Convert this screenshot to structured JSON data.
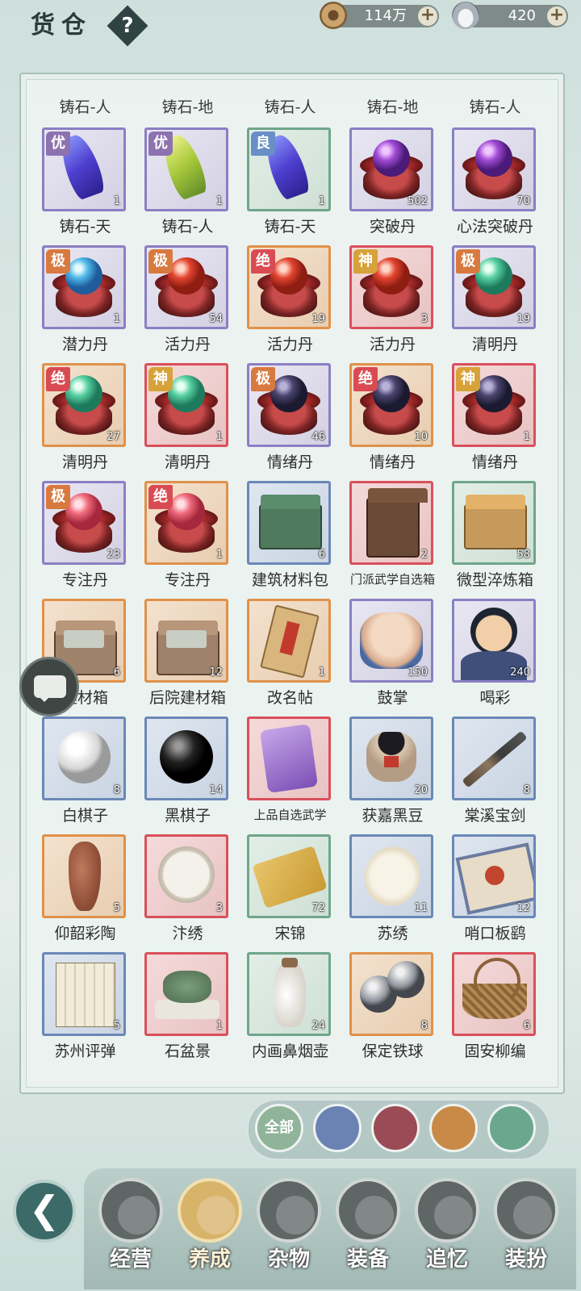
{
  "header": {
    "title": "货仓",
    "help_icon_text": "?",
    "coins": "114万",
    "silver": "420",
    "plus": "+"
  },
  "top_row_labels": [
    "铸石-人",
    "铸石-地",
    "铸石-人",
    "铸石-地",
    "铸石-人"
  ],
  "items": [
    {
      "name": "铸石-天",
      "count": "1",
      "badge": "优",
      "rarity": "purple",
      "art": "crystal-blue"
    },
    {
      "name": "铸石-人",
      "count": "1",
      "badge": "优",
      "rarity": "purple",
      "art": "crystal-yellow"
    },
    {
      "name": "铸石-天",
      "count": "1",
      "badge": "良",
      "rarity": "green",
      "art": "crystal-blue"
    },
    {
      "name": "突破丹",
      "count": "502",
      "badge": "",
      "rarity": "purple",
      "art": "orb-purple"
    },
    {
      "name": "心法突破丹",
      "count": "70",
      "badge": "",
      "rarity": "purple",
      "art": "orb-purple"
    },
    {
      "name": "潜力丹",
      "count": "1",
      "badge": "极",
      "rarity": "purple",
      "art": "orb-cyan"
    },
    {
      "name": "活力丹",
      "count": "54",
      "badge": "极",
      "rarity": "purple",
      "art": "orb-red"
    },
    {
      "name": "活力丹",
      "count": "19",
      "badge": "绝",
      "rarity": "orange",
      "art": "orb-red"
    },
    {
      "name": "活力丹",
      "count": "3",
      "badge": "神",
      "rarity": "red",
      "art": "orb-red"
    },
    {
      "name": "清明丹",
      "count": "19",
      "badge": "极",
      "rarity": "purple",
      "art": "orb-green"
    },
    {
      "name": "清明丹",
      "count": "27",
      "badge": "绝",
      "rarity": "orange",
      "art": "orb-green"
    },
    {
      "name": "清明丹",
      "count": "1",
      "badge": "神",
      "rarity": "red",
      "art": "orb-green"
    },
    {
      "name": "情绪丹",
      "count": "46",
      "badge": "极",
      "rarity": "purple",
      "art": "orb-dark"
    },
    {
      "name": "情绪丹",
      "count": "10",
      "badge": "绝",
      "rarity": "orange",
      "art": "orb-dark"
    },
    {
      "name": "情绪丹",
      "count": "1",
      "badge": "神",
      "rarity": "red",
      "art": "orb-dark"
    },
    {
      "name": "专注丹",
      "count": "23",
      "badge": "极",
      "rarity": "purple",
      "art": "orb-pink"
    },
    {
      "name": "专注丹",
      "count": "1",
      "badge": "绝",
      "rarity": "orange",
      "art": "orb-pink"
    },
    {
      "name": "建筑材料包",
      "count": "6",
      "badge": "",
      "rarity": "blue",
      "art": "chest-green"
    },
    {
      "name": "门派武学自选箱",
      "count": "2",
      "badge": "",
      "rarity": "red",
      "art": "cabinet"
    },
    {
      "name": "微型淬炼箱",
      "count": "58",
      "badge": "",
      "rarity": "green",
      "art": "chest-wood"
    },
    {
      "name": "建材箱",
      "count": "6",
      "badge": "",
      "rarity": "orange",
      "art": "box-open"
    },
    {
      "name": "后院建材箱",
      "count": "12",
      "badge": "",
      "rarity": "orange",
      "art": "box-open"
    },
    {
      "name": "改名帖",
      "count": "1",
      "badge": "",
      "rarity": "orange",
      "art": "card"
    },
    {
      "name": "鼓掌",
      "count": "150",
      "badge": "",
      "rarity": "purple",
      "art": "clap"
    },
    {
      "name": "喝彩",
      "count": "240",
      "badge": "",
      "rarity": "purple",
      "art": "cheer"
    },
    {
      "name": "白棋子",
      "count": "8",
      "badge": "",
      "rarity": "blue",
      "art": "stone-white"
    },
    {
      "name": "黑棋子",
      "count": "14",
      "badge": "",
      "rarity": "blue",
      "art": "stone-black"
    },
    {
      "name": "上品自选武学",
      "count": "",
      "badge": "",
      "rarity": "red",
      "art": "manual"
    },
    {
      "name": "获嘉黑豆",
      "count": "20",
      "badge": "",
      "rarity": "blue",
      "art": "jar"
    },
    {
      "name": "棠溪宝剑",
      "count": "8",
      "badge": "",
      "rarity": "blue",
      "art": "sword"
    },
    {
      "name": "仰韶彩陶",
      "count": "5",
      "badge": "",
      "rarity": "orange",
      "art": "vase"
    },
    {
      "name": "汴绣",
      "count": "3",
      "badge": "",
      "rarity": "red",
      "art": "embroidery"
    },
    {
      "name": "宋锦",
      "count": "72",
      "badge": "",
      "rarity": "green",
      "art": "scroll"
    },
    {
      "name": "苏绣",
      "count": "11",
      "badge": "",
      "rarity": "blue",
      "art": "fan"
    },
    {
      "name": "哨口板鹞",
      "count": "12",
      "badge": "",
      "rarity": "blue",
      "art": "kite"
    },
    {
      "name": "苏州评弹",
      "count": "5",
      "badge": "",
      "rarity": "blue",
      "art": "book"
    },
    {
      "name": "石盆景",
      "count": "1",
      "badge": "",
      "rarity": "red",
      "art": "bonsai"
    },
    {
      "name": "内画鼻烟壶",
      "count": "24",
      "badge": "",
      "rarity": "green",
      "art": "bottle"
    },
    {
      "name": "保定铁球",
      "count": "8",
      "badge": "",
      "rarity": "orange",
      "art": "balls"
    },
    {
      "name": "固安柳编",
      "count": "6",
      "badge": "",
      "rarity": "red",
      "art": "basket"
    }
  ],
  "filters": [
    {
      "label": "全部",
      "icon": "all-icon",
      "color": "#8fb49a"
    },
    {
      "label": "",
      "icon": "bag-icon",
      "color": "#6a83b3"
    },
    {
      "label": "",
      "icon": "tools-icon",
      "color": "#9a4b55"
    },
    {
      "label": "",
      "icon": "cloth-roll-icon",
      "color": "#c88a46"
    },
    {
      "label": "",
      "icon": "umbrella-icon",
      "color": "#6aa78e"
    }
  ],
  "nav": [
    {
      "label": "经营",
      "icon": "bowl-icon",
      "active": false
    },
    {
      "label": "养成",
      "icon": "orb-icon",
      "active": true
    },
    {
      "label": "杂物",
      "icon": "bundle-icon",
      "active": false
    },
    {
      "label": "装备",
      "icon": "robe-icon",
      "active": false
    },
    {
      "label": "追忆",
      "icon": "letter-icon",
      "active": false
    },
    {
      "label": "装扮",
      "icon": "pavilion-icon",
      "active": false
    }
  ],
  "back_label": "❮"
}
